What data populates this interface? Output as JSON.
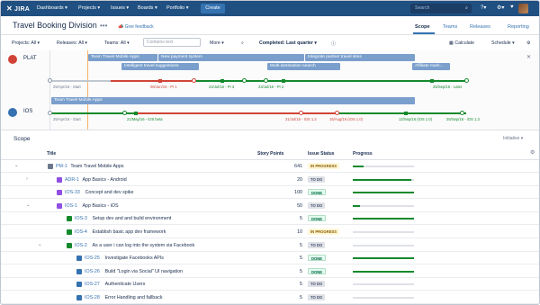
{
  "nav": {
    "logo": "JIRA",
    "menu": [
      "Dashboards ▾",
      "Projects ▾",
      "Issues ▾",
      "Boards ▾",
      "Portfolio ▾"
    ],
    "create": "Create",
    "search_placeholder": "Search",
    "help_icon": "?▾",
    "settings_icon": "⚙▾",
    "bell_icon": "♥"
  },
  "header": {
    "title": "Travel Booking Division",
    "menu_dots": "•••",
    "feedback": "Give feedback",
    "tabs": [
      "Scope",
      "Teams",
      "Releases",
      "Reporting"
    ],
    "active_tab": "Scope"
  },
  "filters": {
    "projects": "Projects: All ▾",
    "releases": "Releases: All ▾",
    "teams": "Teams: All ▾",
    "contains_placeholder": "Contains text",
    "more": "More ▾",
    "completed": "Completed: Last quarter ▾",
    "calculate": "Calculate",
    "schedule": "Schedule ▾"
  },
  "timeline": {
    "projects": [
      {
        "key": "PLAT",
        "color": "#d04437"
      },
      {
        "key": "IOS",
        "color": "#3572b0"
      }
    ],
    "epic_bars_plat": [
      "Team Travel Mobile Apps",
      "New payment system",
      "Integrate partner travel sites",
      "Intelligent travel suggestions",
      "Multi-destination search",
      "Affiliate mark..."
    ],
    "epic_bars_ios": [
      "Team Travel Mobile Apps"
    ],
    "plat_labels": [
      "25/Apr/16 - Start",
      "08/Jun/16 - PI 1",
      "24/Jul/16 - PI 3",
      "23/Jul/16 - PI 2",
      "25/Sep/16 - Later"
    ],
    "ios_labels": [
      "25/Apr/16 - Start",
      "21/May/16 - iOS beta",
      "31/Jul/16 - iOS 1.2",
      "16/Aug/16 (iOS 1.0)",
      "12/Sep/16 (iOS 1.0)",
      "25/Sep/16 - iOS 1.3"
    ]
  },
  "scope": {
    "title": "Scope",
    "initiative": "Initiative ▾",
    "columns": {
      "title": "Title",
      "points": "Story Points",
      "status": "Issue Status",
      "progress": "Progress"
    },
    "rows": [
      {
        "twisty": "⌄",
        "key": "PM-1",
        "summary": "Team Travel Mobile Apps",
        "points": "641",
        "status": "IN PROGRESS",
        "progress": 0.17
      },
      {
        "twisty": "›",
        "key": "ADR-1",
        "summary": "App Basics - Android",
        "points": "20",
        "status": "TO DO",
        "progress": 0.95
      },
      {
        "twisty": "",
        "key": "IOS-33",
        "summary": "Concept and dev spike",
        "points": "100",
        "status": "DONE",
        "progress": 1.0
      },
      {
        "twisty": "⌄",
        "key": "IOS-1",
        "summary": "App Basics - iOS",
        "points": "50",
        "status": "TO DO",
        "progress": 0.12
      },
      {
        "twisty": "",
        "key": "IOS-3",
        "summary": "Setup dev and and build environment",
        "points": "5",
        "status": "DONE",
        "progress": 1.0
      },
      {
        "twisty": "",
        "key": "IOS-4",
        "summary": "Establish basic app dev framework",
        "points": "10",
        "status": "IN PROGRESS",
        "progress": 0.0
      },
      {
        "twisty": "⌄",
        "key": "IOS-2",
        "summary": "As a user i can log into the system via Facebook",
        "points": "5",
        "status": "TO DO",
        "progress": 0.0
      },
      {
        "twisty": "",
        "key": "IOS-25",
        "summary": "Investigate Facebooks APIs",
        "points": "5",
        "status": "DONE",
        "progress": 1.0
      },
      {
        "twisty": "",
        "key": "IOS-26",
        "summary": "Build \"Login via Social\" UI navigation",
        "points": "5",
        "status": "DONE",
        "progress": 1.0
      },
      {
        "twisty": "",
        "key": "IOS-27",
        "summary": "Authenticate Users",
        "points": "5",
        "status": "TO DO",
        "progress": 0.0
      },
      {
        "twisty": "",
        "key": "IOS-28",
        "summary": "Error Handling and fallback",
        "points": "5",
        "status": "TO DO",
        "progress": 0.0
      }
    ]
  },
  "colors": {
    "nav": "#205081",
    "link": "#3572b0",
    "done": "#14892c",
    "late": "#d04437",
    "epic": "#7a9fcc"
  }
}
